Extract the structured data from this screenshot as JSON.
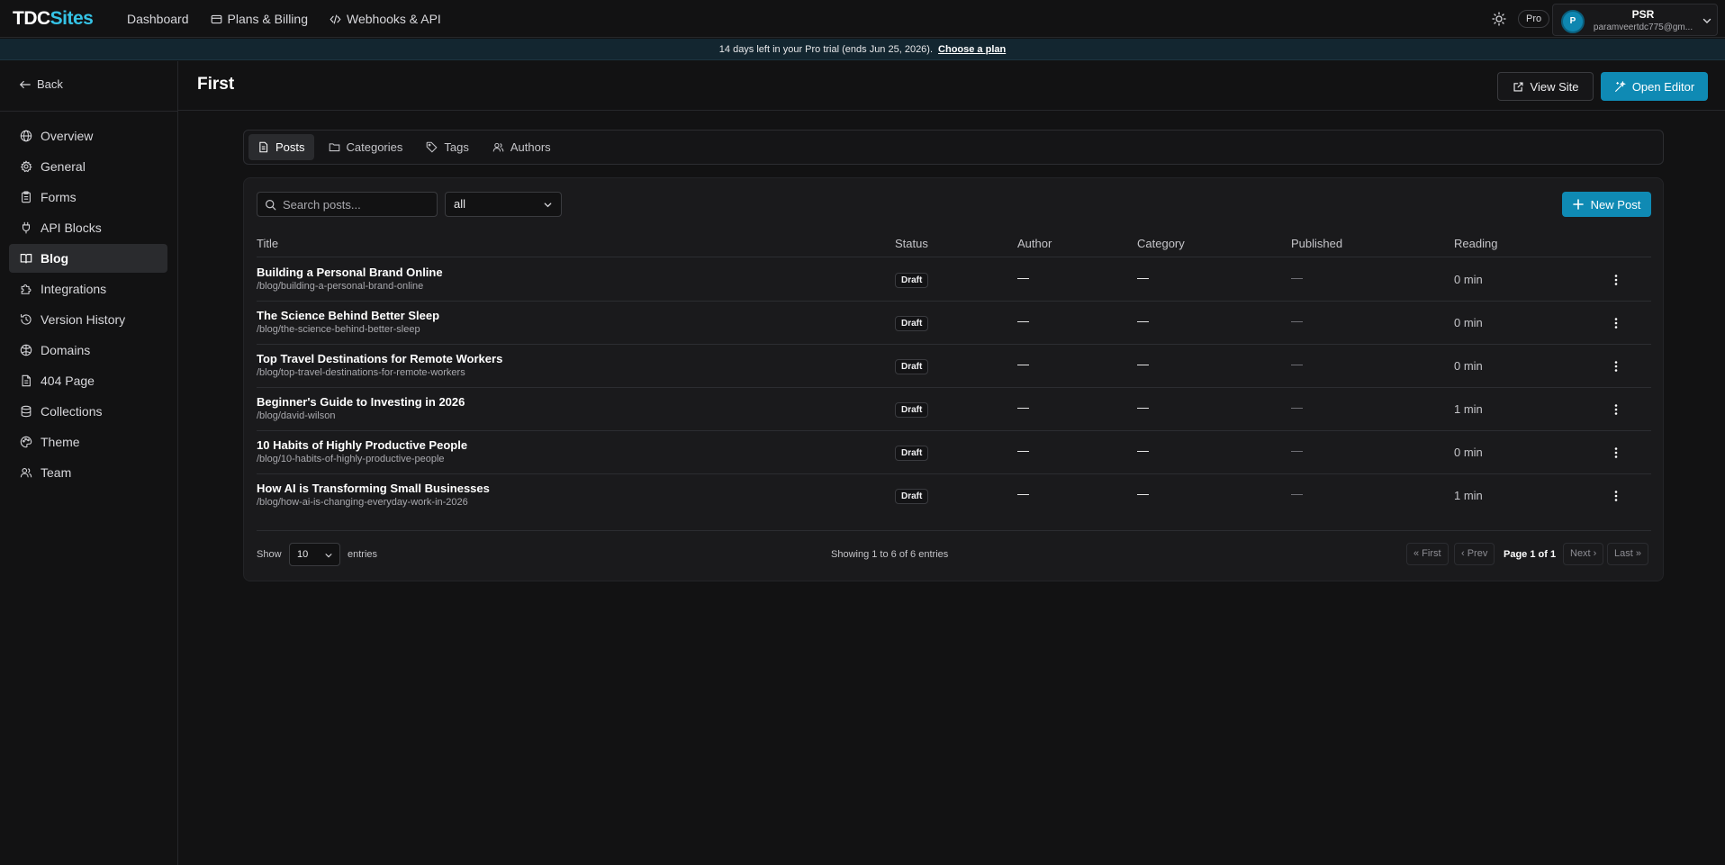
{
  "app": {
    "logo_part1": "TDC",
    "logo_part2": "Sites",
    "nav": [
      {
        "label": "Dashboard"
      },
      {
        "label": "Plans & Billing",
        "icon": "card-icon"
      },
      {
        "label": "Webhooks & API",
        "icon": "code-icon"
      }
    ],
    "plan_badge": "Pro",
    "user": {
      "initial": "P",
      "name": "PSR",
      "email": "paramveertdc775@gm..."
    }
  },
  "banner": {
    "text": "14 days left in your Pro trial (ends Jun 25, 2026).",
    "link": "Choose a plan"
  },
  "sidebar": {
    "back_label": "Back",
    "items": [
      {
        "label": "Overview",
        "icon": "globe-icon"
      },
      {
        "label": "General",
        "icon": "gear-icon"
      },
      {
        "label": "Forms",
        "icon": "clipboard-icon"
      },
      {
        "label": "API Blocks",
        "icon": "plug-icon"
      },
      {
        "label": "Blog",
        "icon": "book-icon",
        "active": true
      },
      {
        "label": "Integrations",
        "icon": "puzzle-icon"
      },
      {
        "label": "Version History",
        "icon": "history-icon"
      },
      {
        "label": "Domains",
        "icon": "domain-icon"
      },
      {
        "label": "404 Page",
        "icon": "file-icon"
      },
      {
        "label": "Collections",
        "icon": "database-icon"
      },
      {
        "label": "Theme",
        "icon": "palette-icon"
      },
      {
        "label": "Team",
        "icon": "users-icon"
      }
    ]
  },
  "page": {
    "title": "First",
    "view_site_label": "View Site",
    "open_editor_label": "Open Editor"
  },
  "tabs": [
    {
      "label": "Posts",
      "active": true
    },
    {
      "label": "Categories"
    },
    {
      "label": "Tags"
    },
    {
      "label": "Authors"
    }
  ],
  "toolbar": {
    "search_placeholder": "Search posts...",
    "filter_value": "all",
    "new_post_label": "New Post"
  },
  "table": {
    "columns": [
      "Title",
      "Status",
      "Author",
      "Category",
      "Published",
      "Reading"
    ],
    "rows": [
      {
        "title": "Building a Personal Brand Online",
        "slug": "/blog/building-a-personal-brand-online",
        "status": "Draft",
        "author": "—",
        "category": "—",
        "published": "—",
        "reading": "0 min"
      },
      {
        "title": "The Science Behind Better Sleep",
        "slug": "/blog/the-science-behind-better-sleep",
        "status": "Draft",
        "author": "—",
        "category": "—",
        "published": "—",
        "reading": "0 min"
      },
      {
        "title": "Top Travel Destinations for Remote Workers",
        "slug": "/blog/top-travel-destinations-for-remote-workers",
        "status": "Draft",
        "author": "—",
        "category": "—",
        "published": "—",
        "reading": "0 min"
      },
      {
        "title": "Beginner's Guide to Investing in 2026",
        "slug": "/blog/david-wilson",
        "status": "Draft",
        "author": "—",
        "category": "—",
        "published": "—",
        "reading": "1 min"
      },
      {
        "title": "10 Habits of Highly Productive People",
        "slug": "/blog/10-habits-of-highly-productive-people",
        "status": "Draft",
        "author": "—",
        "category": "—",
        "published": "—",
        "reading": "0 min"
      },
      {
        "title": "How AI is Transforming Small Businesses",
        "slug": "/blog/how-ai-is-changing-everyday-work-in-2026",
        "status": "Draft",
        "author": "—",
        "category": "—",
        "published": "—",
        "reading": "1 min"
      }
    ]
  },
  "pagination": {
    "show_label": "Show",
    "page_size": "10",
    "entries_label": "entries",
    "summary": "Showing 1 to 6 of 6 entries",
    "first": "« First",
    "prev": "‹ Prev",
    "page_info": "Page 1 of 1",
    "next": "Next ›",
    "last": "Last »"
  },
  "colors": {
    "accent": "#0f8ab4",
    "logo_accent": "#35c3e6",
    "background": "#121213",
    "card": "#1a1a1c"
  }
}
